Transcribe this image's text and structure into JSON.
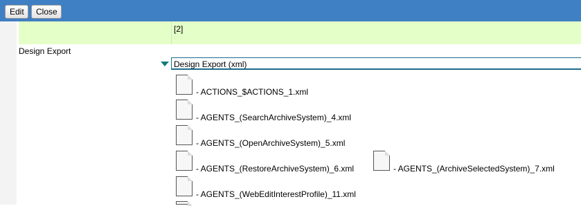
{
  "toolbar": {
    "edit_label": "Edit",
    "close_label": "Close"
  },
  "row": {
    "value": "[2]"
  },
  "field": {
    "label": "Design Export"
  },
  "section": {
    "title": "Design Export (xml)"
  },
  "attachments": [
    "- ACTIONS_$ACTIONS_1.xml",
    "- AGENTS_(SearchArchiveSystem)_4.xml",
    "- AGENTS_(OpenArchiveSystem)_5.xml",
    "- AGENTS_(RestoreArchiveSystem)_6.xml",
    "- AGENTS_(ArchiveSelectedSystem)_7.xml",
    "- AGENTS_(WebEditInterestProfile)_11.xml"
  ],
  "colors": {
    "toolbar": "#3f7fc3",
    "row_highlight": "#e4ffc8",
    "twisty": "#157a7a"
  }
}
